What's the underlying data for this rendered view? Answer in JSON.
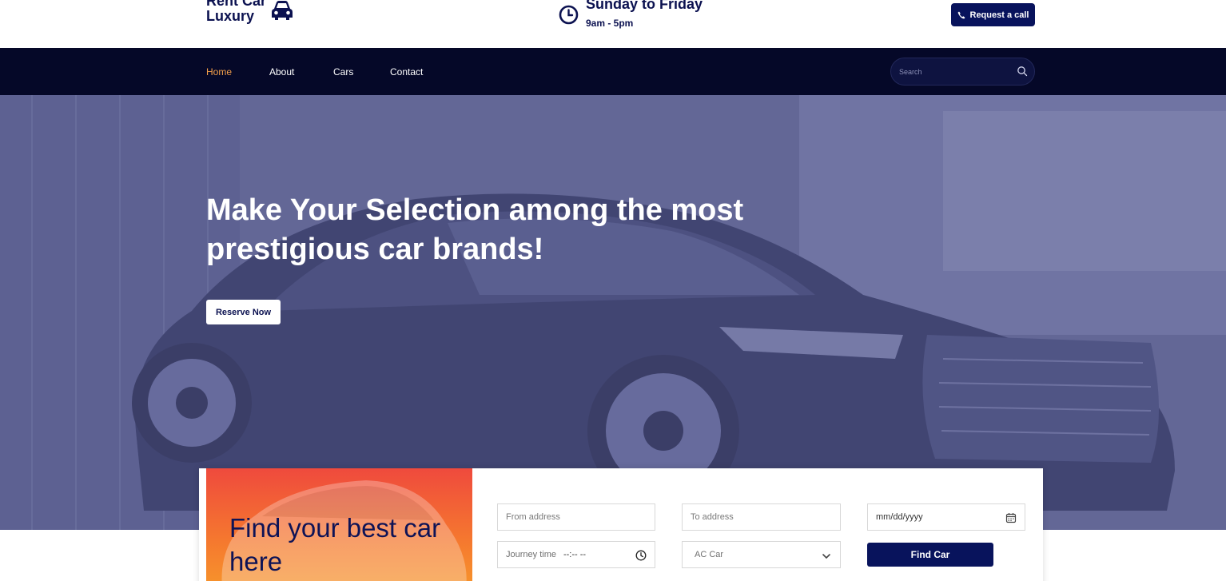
{
  "header": {
    "logo_line1": "Rent Car",
    "logo_line2": "Luxury",
    "hours_days": "Sunday to Friday",
    "hours_time": "9am - 5pm",
    "request_call_label": "Request a call"
  },
  "nav": {
    "items": [
      {
        "label": "Home",
        "active": true
      },
      {
        "label": "About",
        "active": false
      },
      {
        "label": "Cars",
        "active": false
      },
      {
        "label": "Contact",
        "active": false
      }
    ],
    "search_placeholder": "Search"
  },
  "hero": {
    "title": "Make Your Selection among the most prestigious car brands!",
    "reserve_label": "Reserve Now"
  },
  "booking": {
    "promo_text": "Find your best car here",
    "from_placeholder": "From address",
    "to_placeholder": "To address",
    "date_placeholder": "mm/dd/yyyy",
    "journey_label": "Journey time",
    "journey_value": "--:-- --",
    "car_type_selected": "AC Car",
    "find_label": "Find Car"
  },
  "colors": {
    "brand_navy": "#08135c",
    "nav_bg": "#050828",
    "active_nav": "#f5a04a",
    "promo_start": "#ef4a3d",
    "promo_end": "#f7992b"
  }
}
